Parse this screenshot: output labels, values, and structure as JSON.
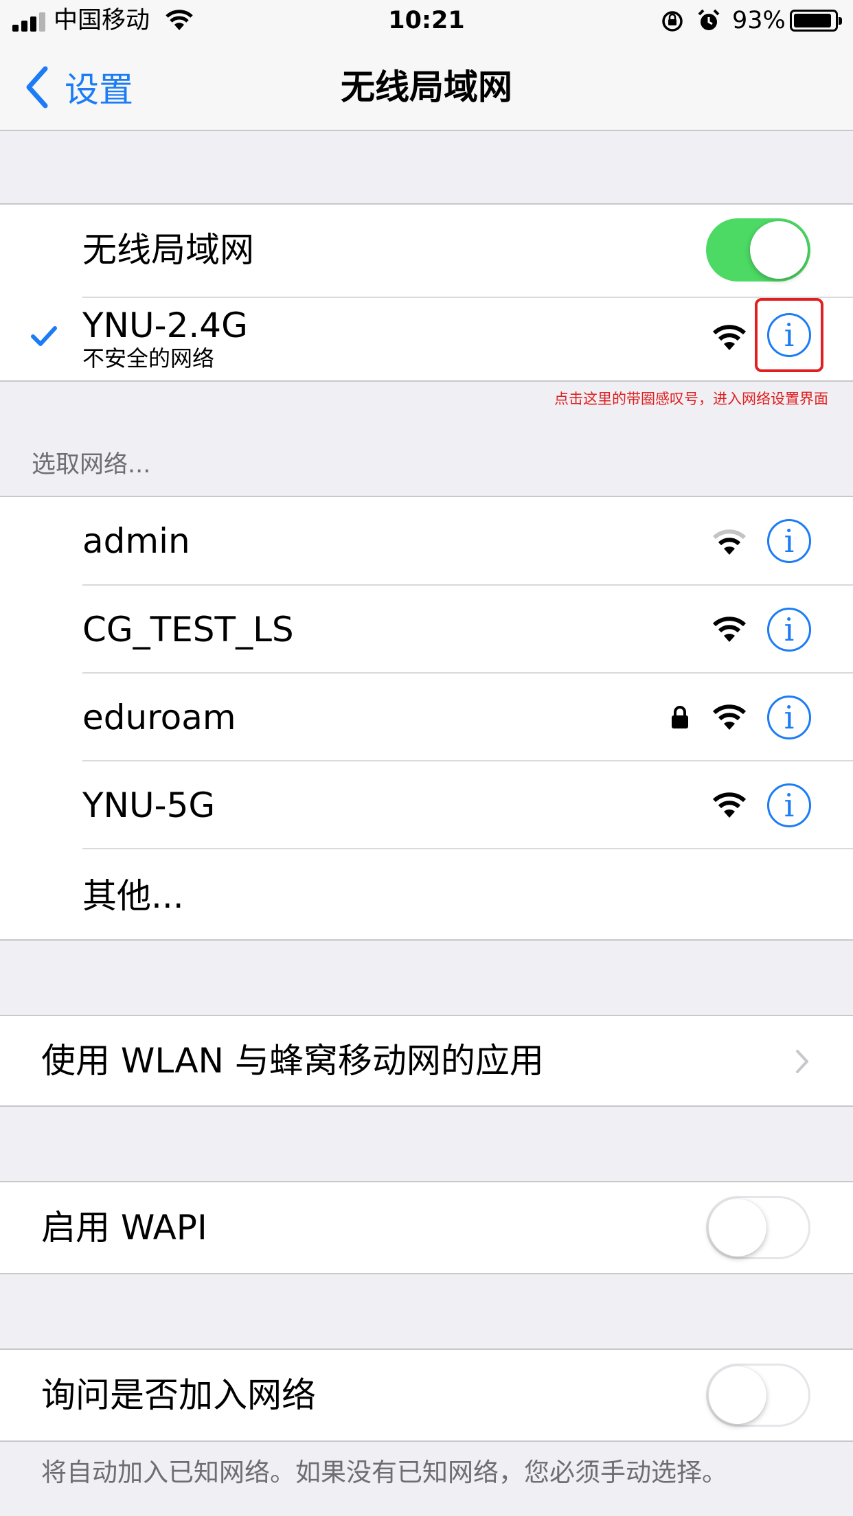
{
  "status_bar": {
    "carrier": "中国移动",
    "time": "10:21",
    "battery_percent": "93%",
    "battery_level": 0.93
  },
  "nav": {
    "back_label": "设置",
    "title": "无线局域网"
  },
  "wifi_toggle": {
    "label": "无线局域网",
    "on": true
  },
  "connected_network": {
    "name": "YNU-2.4G",
    "subtitle": "不安全的网络",
    "signal_bars": 3
  },
  "annotation": "点击这里的带圈感叹号，进入网络设置界面",
  "networks_header": "选取网络...",
  "networks": [
    {
      "name": "admin",
      "locked": false,
      "signal_bars": 2
    },
    {
      "name": "CG_TEST_LS",
      "locked": false,
      "signal_bars": 3
    },
    {
      "name": "eduroam",
      "locked": true,
      "signal_bars": 3
    },
    {
      "name": "YNU-5G",
      "locked": false,
      "signal_bars": 3
    }
  ],
  "other_label": "其他...",
  "apps_row": {
    "label": "使用 WLAN 与蜂窝移动网的应用"
  },
  "wapi_row": {
    "label": "启用 WAPI",
    "on": false
  },
  "ask_join_row": {
    "label": "询问是否加入网络",
    "on": false
  },
  "footer_text": "将自动加入已知网络。如果没有已知网络，您必须手动选择。",
  "colors": {
    "accent": "#1b7cf5",
    "toggle_on": "#4cd964",
    "annotation": "#e02020",
    "background": "#efeff4"
  }
}
